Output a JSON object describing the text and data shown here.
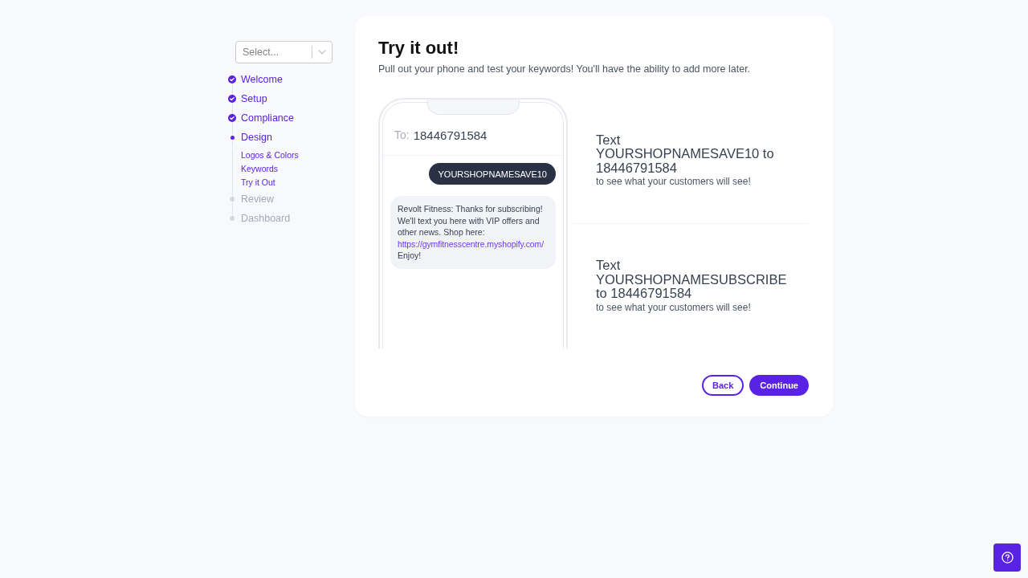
{
  "sidebar": {
    "select": {
      "placeholder": "Select..."
    },
    "steps": [
      {
        "label": "Welcome",
        "done": true,
        "active": false
      },
      {
        "label": "Setup",
        "done": true,
        "active": false
      },
      {
        "label": "Compliance",
        "done": true,
        "active": false
      },
      {
        "label": "Design",
        "done": false,
        "active": true,
        "children": [
          {
            "label": "Logos & Colors"
          },
          {
            "label": "Keywords"
          },
          {
            "label": "Try it Out"
          }
        ]
      },
      {
        "label": "Review",
        "done": false,
        "active": false
      },
      {
        "label": "Dashboard",
        "done": false,
        "active": false
      }
    ]
  },
  "card": {
    "title": "Try it out!",
    "subtitle": "Pull out your phone and test your keywords! You'll have the ability to add more later.",
    "phone": {
      "to_label": "To:",
      "to_number": "18446791584",
      "messages": [
        {
          "kind": "sent",
          "text": "YOURSHOPNAMESAVE10"
        },
        {
          "kind": "received",
          "text": "Revolt Fitness: Thanks for subscribing! We'll text you here with VIP offers and other news. Shop here:",
          "link": "https://gymfitnesscentre.myshopify.com/",
          "text_after": "Enjoy!"
        }
      ]
    },
    "keywords": [
      {
        "heading": "Text YOURSHOPNAMESAVE10 to 18446791584",
        "caption": "to see what your customers will see!"
      },
      {
        "heading": "Text YOURSHOPNAMESUBSCRIBE to 18446791584",
        "caption": "to see what your customers will see!"
      }
    ],
    "buttons": [
      {
        "label": "Back",
        "kind": "secondary"
      },
      {
        "label": "Continue",
        "kind": "primary"
      }
    ]
  }
}
